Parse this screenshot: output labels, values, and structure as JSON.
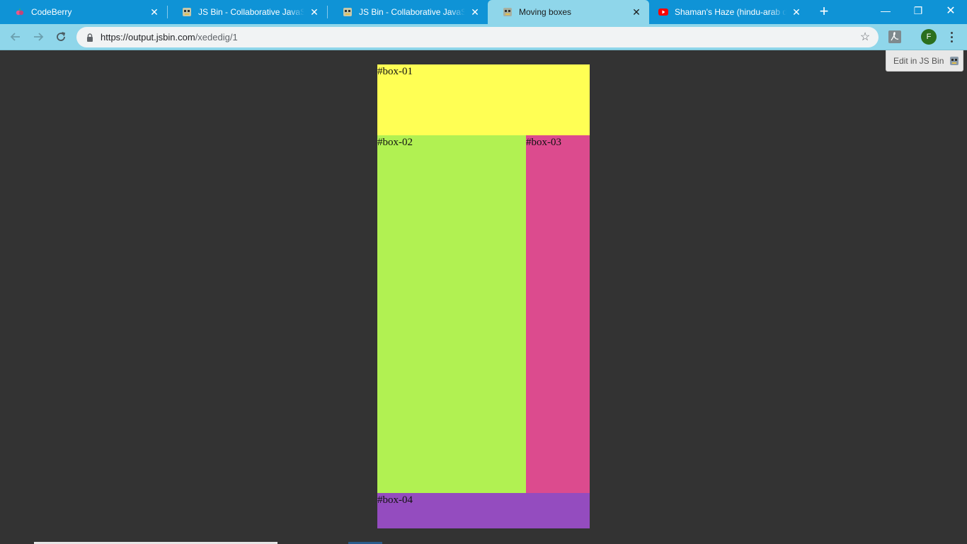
{
  "browser": {
    "tabs": [
      {
        "title": "CodeBerry",
        "favicon": "codeberry-icon"
      },
      {
        "title": "JS Bin - Collaborative JavaScript Debugging",
        "favicon": "jsbin-icon"
      },
      {
        "title": "JS Bin - Collaborative JavaScript Debugging",
        "favicon": "jsbin-icon"
      },
      {
        "title": "Moving boxes",
        "favicon": "jsbin-icon",
        "active": true
      },
      {
        "title": "Shaman's Haze (hindu-arab dub)",
        "favicon": "youtube-icon"
      }
    ],
    "new_tab_glyph": "+",
    "window_controls": {
      "minimize": "—",
      "restore": "❐",
      "close": "✕"
    },
    "url_host": "https://output.jsbin.com",
    "url_path": "/xededig/1",
    "profile_initial": "F",
    "accent_color": "#0f93d6",
    "toolbar_color": "#8fd6ea"
  },
  "page": {
    "edit_in_jsbin": "Edit in JS Bin",
    "boxes": [
      {
        "label": "#box-01",
        "color": "#ffff54"
      },
      {
        "label": "#box-02",
        "color": "#b1f152"
      },
      {
        "label": "#box-03",
        "color": "#dc4b8e"
      },
      {
        "label": "#box-04",
        "color": "#944cbf"
      }
    ],
    "background_color": "#333333"
  }
}
